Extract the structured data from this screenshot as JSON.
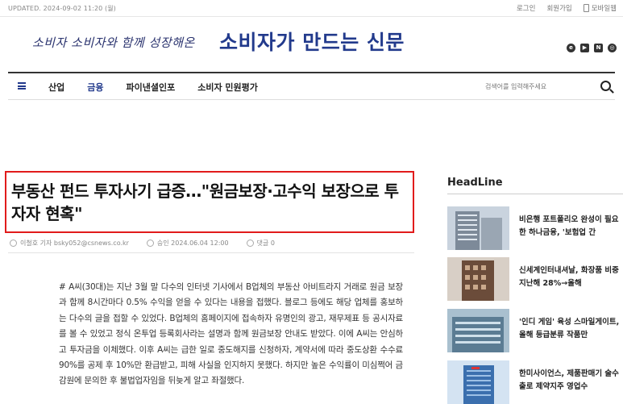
{
  "topbar": {
    "updated": "UPDATED. 2024-09-02 11:20 (월)",
    "login": "로그인",
    "signup": "회원가입",
    "mobile_web": "모바일웹"
  },
  "masthead": {
    "slogan": "소비자 소비자와 함께 성장해온",
    "logo": "소비자가 만드는 신문"
  },
  "nav": {
    "items": [
      {
        "label": "산업",
        "active": false
      },
      {
        "label": "금융",
        "active": true
      },
      {
        "label": "파이낸셜인포",
        "active": false
      },
      {
        "label": "소비자 민원평가",
        "active": false
      }
    ],
    "search_placeholder": "검색어를 입력해주세요"
  },
  "article": {
    "headline": "부동산 펀드 투자사기 급증…\"원금보장·고수익 보장으로 투자자 현혹\"",
    "reporter": "이철호 기자 bsky052@csnews.co.kr",
    "approved": "승인 2024.06.04 12:00",
    "comments": "댓글 0",
    "body": "# A씨(30대)는 지난 3월 말 다수의 인터넷 기사에서 B업체의 부동산 아비트라지 거래로 원금 보장과 함께 8시간마다 0.5% 수익을 얻을 수 있다는 내용을 접했다. 블로그 등에도 해당 업체를 홍보하는 다수의 글을 접할 수 있었다. B업체의 홈페이지에 접속하자 유명인의 광고, 재무제표 등 공시자료를 볼 수 있었고 정식 온투업 등록회사라는 설명과 함께 원금보장 안내도 받았다. 이에 A씨는 안심하고 투자금을 이체했다. 이후 A씨는 급한 일로 중도해지를 신청하자, 계약서에 따라 중도상환 수수료 90%를 공제 후 10%만 환급받고, 피해 사실을 인지하지 못했다. 하지만 높은 수익률이 미심쩍어 금감원에 문의한 후 불법업자임을 뒤늦게 알고 좌절했다."
  },
  "sidebar": {
    "title": "HeadLine",
    "items": [
      {
        "text": "비은행 포트폴리오 완성이 필요한 하나금융, '보험업 간",
        "thumb_color": "#b9c3cf"
      },
      {
        "text": "신세계인터내셔날, 화장품 비중 지난해 28%→올해",
        "thumb_color": "#8a6a55"
      },
      {
        "text": "'인디 게임' 육성 스마일게이트, 올해 등급분류 작품만",
        "thumb_color": "#6f8fa6"
      },
      {
        "text": "한미사이언스, 제품판매기 술수출로 제약지주 영업수",
        "thumb_color": "#4a7fb8"
      }
    ]
  }
}
